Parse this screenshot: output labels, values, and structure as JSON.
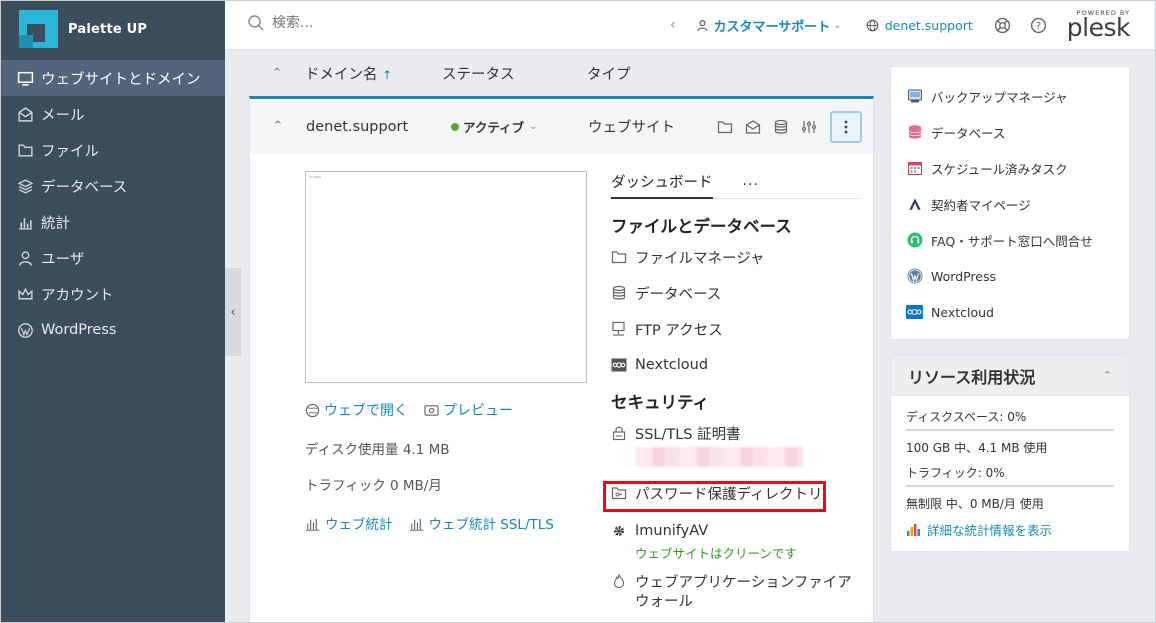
{
  "brand": {
    "name": "Palette UP"
  },
  "sidebar": {
    "items": [
      {
        "label": "ウェブサイトとドメイン",
        "icon": "monitor-icon",
        "active": true
      },
      {
        "label": "メール",
        "icon": "mail-icon"
      },
      {
        "label": "ファイル",
        "icon": "folder-icon"
      },
      {
        "label": "データベース",
        "icon": "stack-icon"
      },
      {
        "label": "統計",
        "icon": "bar-chart-icon"
      },
      {
        "label": "ユーザ",
        "icon": "user-icon"
      },
      {
        "label": "アカウント",
        "icon": "crown-icon"
      },
      {
        "label": "WordPress",
        "icon": "wordpress-icon"
      }
    ]
  },
  "header": {
    "search_placeholder": "検索...",
    "user_menu": "カスタマーサポート",
    "domain": "denet.support",
    "powered_by": "POWERED BY",
    "plesk": "plesk"
  },
  "list": {
    "col_domain": "ドメイン名",
    "col_domain_sort": "↑",
    "col_status": "ステータス",
    "col_type": "タイプ"
  },
  "site": {
    "name": "denet.support",
    "status": "アクティブ",
    "type": "ウェブサイト",
    "open_web": "ウェブで開く",
    "preview": "プレビュー",
    "disk": "ディスク使用量 4.1 MB",
    "traffic": "トラフィック 0 MB/月",
    "web_stats": "ウェブ統計",
    "web_stats_ssl": "ウェブ統計 SSL/TLS"
  },
  "dashboard": {
    "tab": "ダッシュボード",
    "more": "···",
    "files_title": "ファイルとデータベース",
    "files_items": [
      "ファイルマネージャ",
      "データベース",
      "FTP アクセス",
      "Nextcloud"
    ],
    "security_title": "セキュリティ",
    "ssl": "SSL/TLS 証明書",
    "password_dirs": "パスワード保護ディレクトリ",
    "imunify": "ImunifyAV",
    "imunify_status": "ウェブサイトはクリーンです",
    "waf_line1": "ウェブアプリケーションファイア",
    "waf_line2": "ウォール"
  },
  "right_links": [
    {
      "label": "バックアップマネージャ",
      "icon": "backup-icon"
    },
    {
      "label": "データベース",
      "icon": "database-icon"
    },
    {
      "label": "スケジュール済みタスク",
      "icon": "calendar-icon"
    },
    {
      "label": "契約者マイページ",
      "icon": "a-logo-icon"
    },
    {
      "label": "FAQ・サポート窓口へ問合せ",
      "icon": "headset-icon"
    },
    {
      "label": "WordPress",
      "icon": "wordpress-icon"
    },
    {
      "label": "Nextcloud",
      "icon": "nextcloud-icon"
    }
  ],
  "resources": {
    "title": "リソース利用状況",
    "disk_label": "ディスクスペース: 0%",
    "disk_detail": "100 GB 中、4.1 MB 使用",
    "traffic_label": "トラフィック: 0%",
    "traffic_detail": "無制限 中、0 MB/月 使用",
    "details_link": "詳細な統計情報を表示"
  },
  "colors": {
    "accent": "#1a88b4",
    "sidebar": "#3c4d5d",
    "active_green": "#5aaa2a",
    "highlight_red": "#e10d17"
  }
}
